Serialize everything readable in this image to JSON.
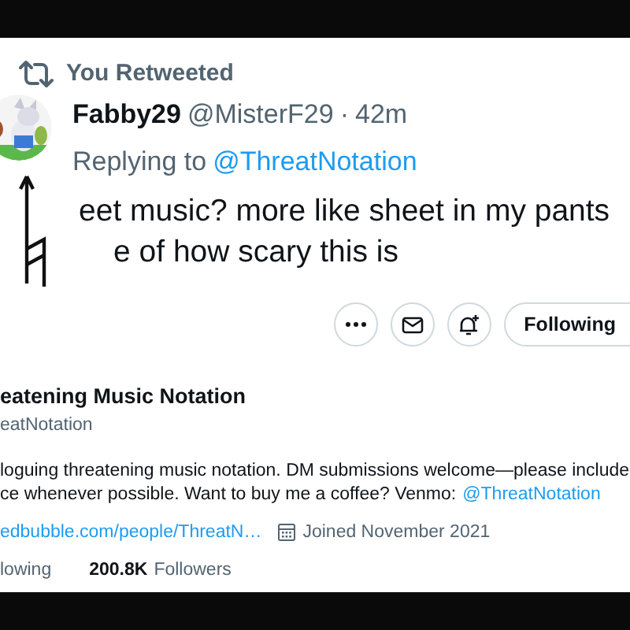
{
  "retweet_banner": "You Retweeted",
  "tweet": {
    "author": "Fabby29",
    "handle": "@MisterF29",
    "separator": "·",
    "time": "42m",
    "replying_label": "Replying to",
    "replying_handle": "@ThreatNotation",
    "text_lines": [
      "eet music? more like sheet in my pants",
      "e of how scary this is"
    ]
  },
  "profile_actions": [
    {
      "kind": "more"
    },
    {
      "kind": "message"
    },
    {
      "kind": "notify"
    },
    {
      "kind": "follow",
      "label": "Following"
    }
  ],
  "profile": {
    "name": "eatening Music Notation",
    "handle": "eatNotation",
    "bio_lines": [
      "loguing threatening music notation. DM submissions welcome—please include",
      "ce whenever possible. Want to buy me a coffee? Venmo:"
    ],
    "bio_mention": "@ThreatNotation",
    "website": "edbubble.com/people/ThreatN…",
    "joined": "Joined November 2021",
    "following_label": "lowing",
    "followers_count": "200.8K",
    "followers_label": "Followers"
  }
}
